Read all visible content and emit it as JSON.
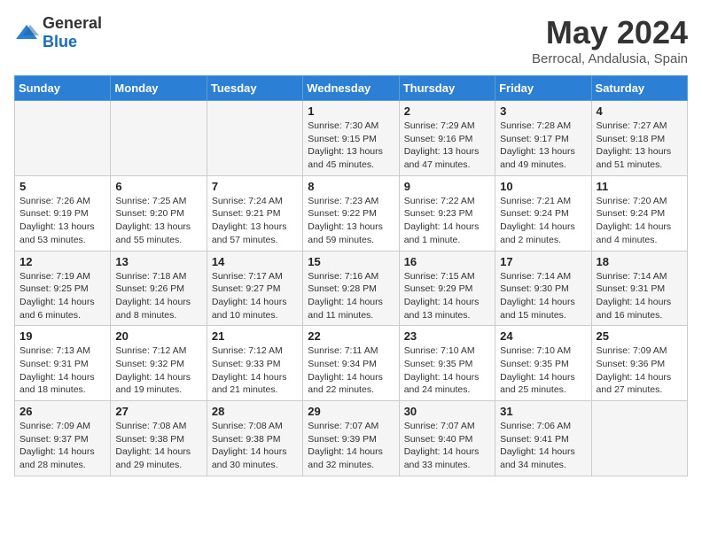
{
  "header": {
    "logo_general": "General",
    "logo_blue": "Blue",
    "month_year": "May 2024",
    "location": "Berrocal, Andalusia, Spain"
  },
  "days_of_week": [
    "Sunday",
    "Monday",
    "Tuesday",
    "Wednesday",
    "Thursday",
    "Friday",
    "Saturday"
  ],
  "weeks": [
    [
      {
        "day": "",
        "info": ""
      },
      {
        "day": "",
        "info": ""
      },
      {
        "day": "",
        "info": ""
      },
      {
        "day": "1",
        "info": "Sunrise: 7:30 AM\nSunset: 9:15 PM\nDaylight: 13 hours\nand 45 minutes."
      },
      {
        "day": "2",
        "info": "Sunrise: 7:29 AM\nSunset: 9:16 PM\nDaylight: 13 hours\nand 47 minutes."
      },
      {
        "day": "3",
        "info": "Sunrise: 7:28 AM\nSunset: 9:17 PM\nDaylight: 13 hours\nand 49 minutes."
      },
      {
        "day": "4",
        "info": "Sunrise: 7:27 AM\nSunset: 9:18 PM\nDaylight: 13 hours\nand 51 minutes."
      }
    ],
    [
      {
        "day": "5",
        "info": "Sunrise: 7:26 AM\nSunset: 9:19 PM\nDaylight: 13 hours\nand 53 minutes."
      },
      {
        "day": "6",
        "info": "Sunrise: 7:25 AM\nSunset: 9:20 PM\nDaylight: 13 hours\nand 55 minutes."
      },
      {
        "day": "7",
        "info": "Sunrise: 7:24 AM\nSunset: 9:21 PM\nDaylight: 13 hours\nand 57 minutes."
      },
      {
        "day": "8",
        "info": "Sunrise: 7:23 AM\nSunset: 9:22 PM\nDaylight: 13 hours\nand 59 minutes."
      },
      {
        "day": "9",
        "info": "Sunrise: 7:22 AM\nSunset: 9:23 PM\nDaylight: 14 hours\nand 1 minute."
      },
      {
        "day": "10",
        "info": "Sunrise: 7:21 AM\nSunset: 9:24 PM\nDaylight: 14 hours\nand 2 minutes."
      },
      {
        "day": "11",
        "info": "Sunrise: 7:20 AM\nSunset: 9:24 PM\nDaylight: 14 hours\nand 4 minutes."
      }
    ],
    [
      {
        "day": "12",
        "info": "Sunrise: 7:19 AM\nSunset: 9:25 PM\nDaylight: 14 hours\nand 6 minutes."
      },
      {
        "day": "13",
        "info": "Sunrise: 7:18 AM\nSunset: 9:26 PM\nDaylight: 14 hours\nand 8 minutes."
      },
      {
        "day": "14",
        "info": "Sunrise: 7:17 AM\nSunset: 9:27 PM\nDaylight: 14 hours\nand 10 minutes."
      },
      {
        "day": "15",
        "info": "Sunrise: 7:16 AM\nSunset: 9:28 PM\nDaylight: 14 hours\nand 11 minutes."
      },
      {
        "day": "16",
        "info": "Sunrise: 7:15 AM\nSunset: 9:29 PM\nDaylight: 14 hours\nand 13 minutes."
      },
      {
        "day": "17",
        "info": "Sunrise: 7:14 AM\nSunset: 9:30 PM\nDaylight: 14 hours\nand 15 minutes."
      },
      {
        "day": "18",
        "info": "Sunrise: 7:14 AM\nSunset: 9:31 PM\nDaylight: 14 hours\nand 16 minutes."
      }
    ],
    [
      {
        "day": "19",
        "info": "Sunrise: 7:13 AM\nSunset: 9:31 PM\nDaylight: 14 hours\nand 18 minutes."
      },
      {
        "day": "20",
        "info": "Sunrise: 7:12 AM\nSunset: 9:32 PM\nDaylight: 14 hours\nand 19 minutes."
      },
      {
        "day": "21",
        "info": "Sunrise: 7:12 AM\nSunset: 9:33 PM\nDaylight: 14 hours\nand 21 minutes."
      },
      {
        "day": "22",
        "info": "Sunrise: 7:11 AM\nSunset: 9:34 PM\nDaylight: 14 hours\nand 22 minutes."
      },
      {
        "day": "23",
        "info": "Sunrise: 7:10 AM\nSunset: 9:35 PM\nDaylight: 14 hours\nand 24 minutes."
      },
      {
        "day": "24",
        "info": "Sunrise: 7:10 AM\nSunset: 9:35 PM\nDaylight: 14 hours\nand 25 minutes."
      },
      {
        "day": "25",
        "info": "Sunrise: 7:09 AM\nSunset: 9:36 PM\nDaylight: 14 hours\nand 27 minutes."
      }
    ],
    [
      {
        "day": "26",
        "info": "Sunrise: 7:09 AM\nSunset: 9:37 PM\nDaylight: 14 hours\nand 28 minutes."
      },
      {
        "day": "27",
        "info": "Sunrise: 7:08 AM\nSunset: 9:38 PM\nDaylight: 14 hours\nand 29 minutes."
      },
      {
        "day": "28",
        "info": "Sunrise: 7:08 AM\nSunset: 9:38 PM\nDaylight: 14 hours\nand 30 minutes."
      },
      {
        "day": "29",
        "info": "Sunrise: 7:07 AM\nSunset: 9:39 PM\nDaylight: 14 hours\nand 32 minutes."
      },
      {
        "day": "30",
        "info": "Sunrise: 7:07 AM\nSunset: 9:40 PM\nDaylight: 14 hours\nand 33 minutes."
      },
      {
        "day": "31",
        "info": "Sunrise: 7:06 AM\nSunset: 9:41 PM\nDaylight: 14 hours\nand 34 minutes."
      },
      {
        "day": "",
        "info": ""
      }
    ]
  ]
}
